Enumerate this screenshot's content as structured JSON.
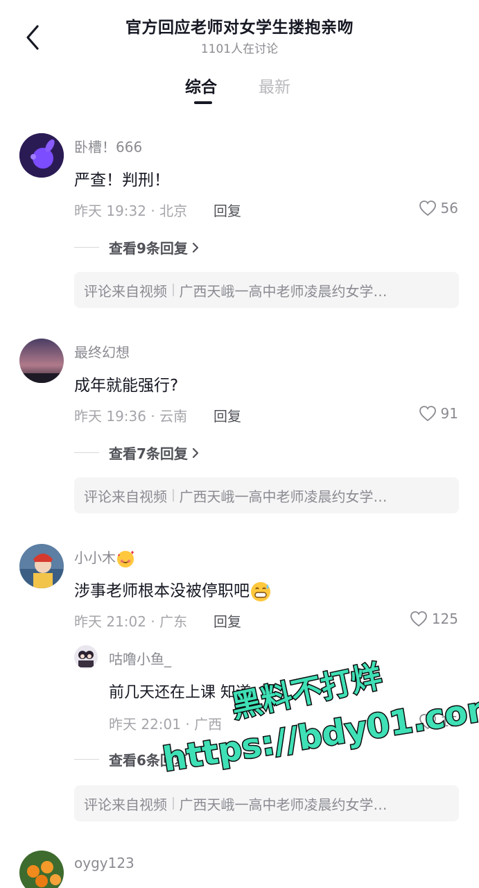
{
  "header": {
    "title": "官方回应老师对女学生搂抱亲吻",
    "subtitle": "1101人在讨论"
  },
  "tabs": [
    {
      "label": "综合",
      "active": true
    },
    {
      "label": "最新",
      "active": false
    }
  ],
  "comments": [
    {
      "username": "卧槽！666",
      "content": "严查！判刑！",
      "time_location": "昨天 19:32 · 北京",
      "reply_label": "回复",
      "likes": "56",
      "view_replies": "查看9条回复",
      "source_label": "评论来自视频",
      "source_title": "广西天峨一高中老师凌晨约女学…"
    },
    {
      "username": "最终幻想",
      "content": "成年就能强行?",
      "time_location": "昨天 19:36 · 云南",
      "reply_label": "回复",
      "likes": "91",
      "view_replies": "查看7条回复",
      "source_label": "评论来自视频",
      "source_title": "广西天峨一高中老师凌晨约女学…"
    },
    {
      "username": "小小木",
      "content": "涉事老师根本没被停职吧",
      "time_location": "昨天 21:02 · 广东",
      "reply_label": "回复",
      "likes": "125",
      "view_replies": "查看6条回复",
      "source_label": "评论来自视频",
      "source_title": "广西天峨一高中老师凌晨约女学…",
      "sub_reply": {
        "username": "咕噜小鱼_",
        "content": "前几天还在上课 知道",
        "time_location": "昨天 22:01 · 广西",
        "likes": "15"
      }
    },
    {
      "username": "oygy123"
    }
  ],
  "watermark": {
    "line1": "黑料不打烊",
    "line2": "https://bdy01.com"
  },
  "colors": {
    "watermark_fill": "#3fe0b6",
    "text_primary": "#161823",
    "text_secondary": "#8a8b91"
  }
}
